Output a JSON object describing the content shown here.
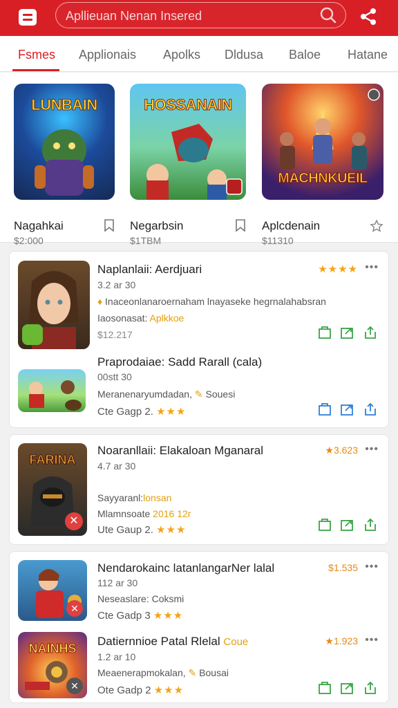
{
  "topbar": {
    "search_text": "Apllieuan Nenan Insered",
    "accent": "#d81f26"
  },
  "tabs": [
    {
      "label": "Fsmes"
    },
    {
      "label": "Applionais"
    },
    {
      "label": "Apolks"
    },
    {
      "label": "Dldusa"
    },
    {
      "label": "Baloe"
    },
    {
      "label": "Hatane"
    }
  ],
  "featured": [
    {
      "title": "Nagahkai",
      "price": "$2:000",
      "art_text": "LUNBAIN",
      "icon": "bookmark-icon"
    },
    {
      "title": "Negarbsin",
      "price": "$1TBM",
      "art_text": "HOSSANAIN",
      "icon": "bookmark-icon"
    },
    {
      "title": "Aplcdenain",
      "price": "$11310",
      "art_text": "MACHNKUEIL",
      "icon": "star-icon"
    }
  ],
  "cards": [
    {
      "apps": [
        {
          "title": "Naplanlaii: Aerdjuari",
          "rating": "★★★★",
          "meta": "3.2 ar 30",
          "desc": "Inaceonlanaroernaham lnayaseke hegrnalahabsran",
          "tag": "Iaosonasat:",
          "tag_hl": "Aplkkoe",
          "extra": "$12.217"
        },
        {
          "title": "Praprodaiae: Sadd Rarall (cala)",
          "rating": "",
          "meta": "00stt 30",
          "desc": "Meranenaryumdadan,",
          "desc2": "Souesi",
          "price": "Cte Gagp 2.",
          "stars": "★★★"
        }
      ]
    },
    {
      "apps": [
        {
          "title": "Noaranllaii: Elakaloan Mganaral",
          "rating": "★3.623",
          "meta": "4.7 ar 30",
          "tag": "Sayyaranl:",
          "tag_hl": "lonsan",
          "desc": "Mlamnsoate",
          "desc_hl": "2016 12r",
          "price": "Ute Gaup 2.",
          "stars": "★★★",
          "art_text": "FARINA"
        }
      ]
    },
    {
      "apps": [
        {
          "title": "Nendarokainc latanlangarNer lalal",
          "rating": "$1.535",
          "meta": "112 ar 30",
          "desc": "Neseaslare: Coksmi",
          "price": "Cte Gadp 3",
          "stars": "★★★"
        },
        {
          "title": "Datiernnioe Patal Rlelal",
          "title_hl": "Coue",
          "rating": "★1.923",
          "meta": "1.2 ar 10",
          "desc": "Meaenerapmokalan,",
          "desc2": "Bousai",
          "price": "Ote Gadp 2",
          "stars": "★★★",
          "art_text": "NAINHS"
        }
      ]
    }
  ]
}
